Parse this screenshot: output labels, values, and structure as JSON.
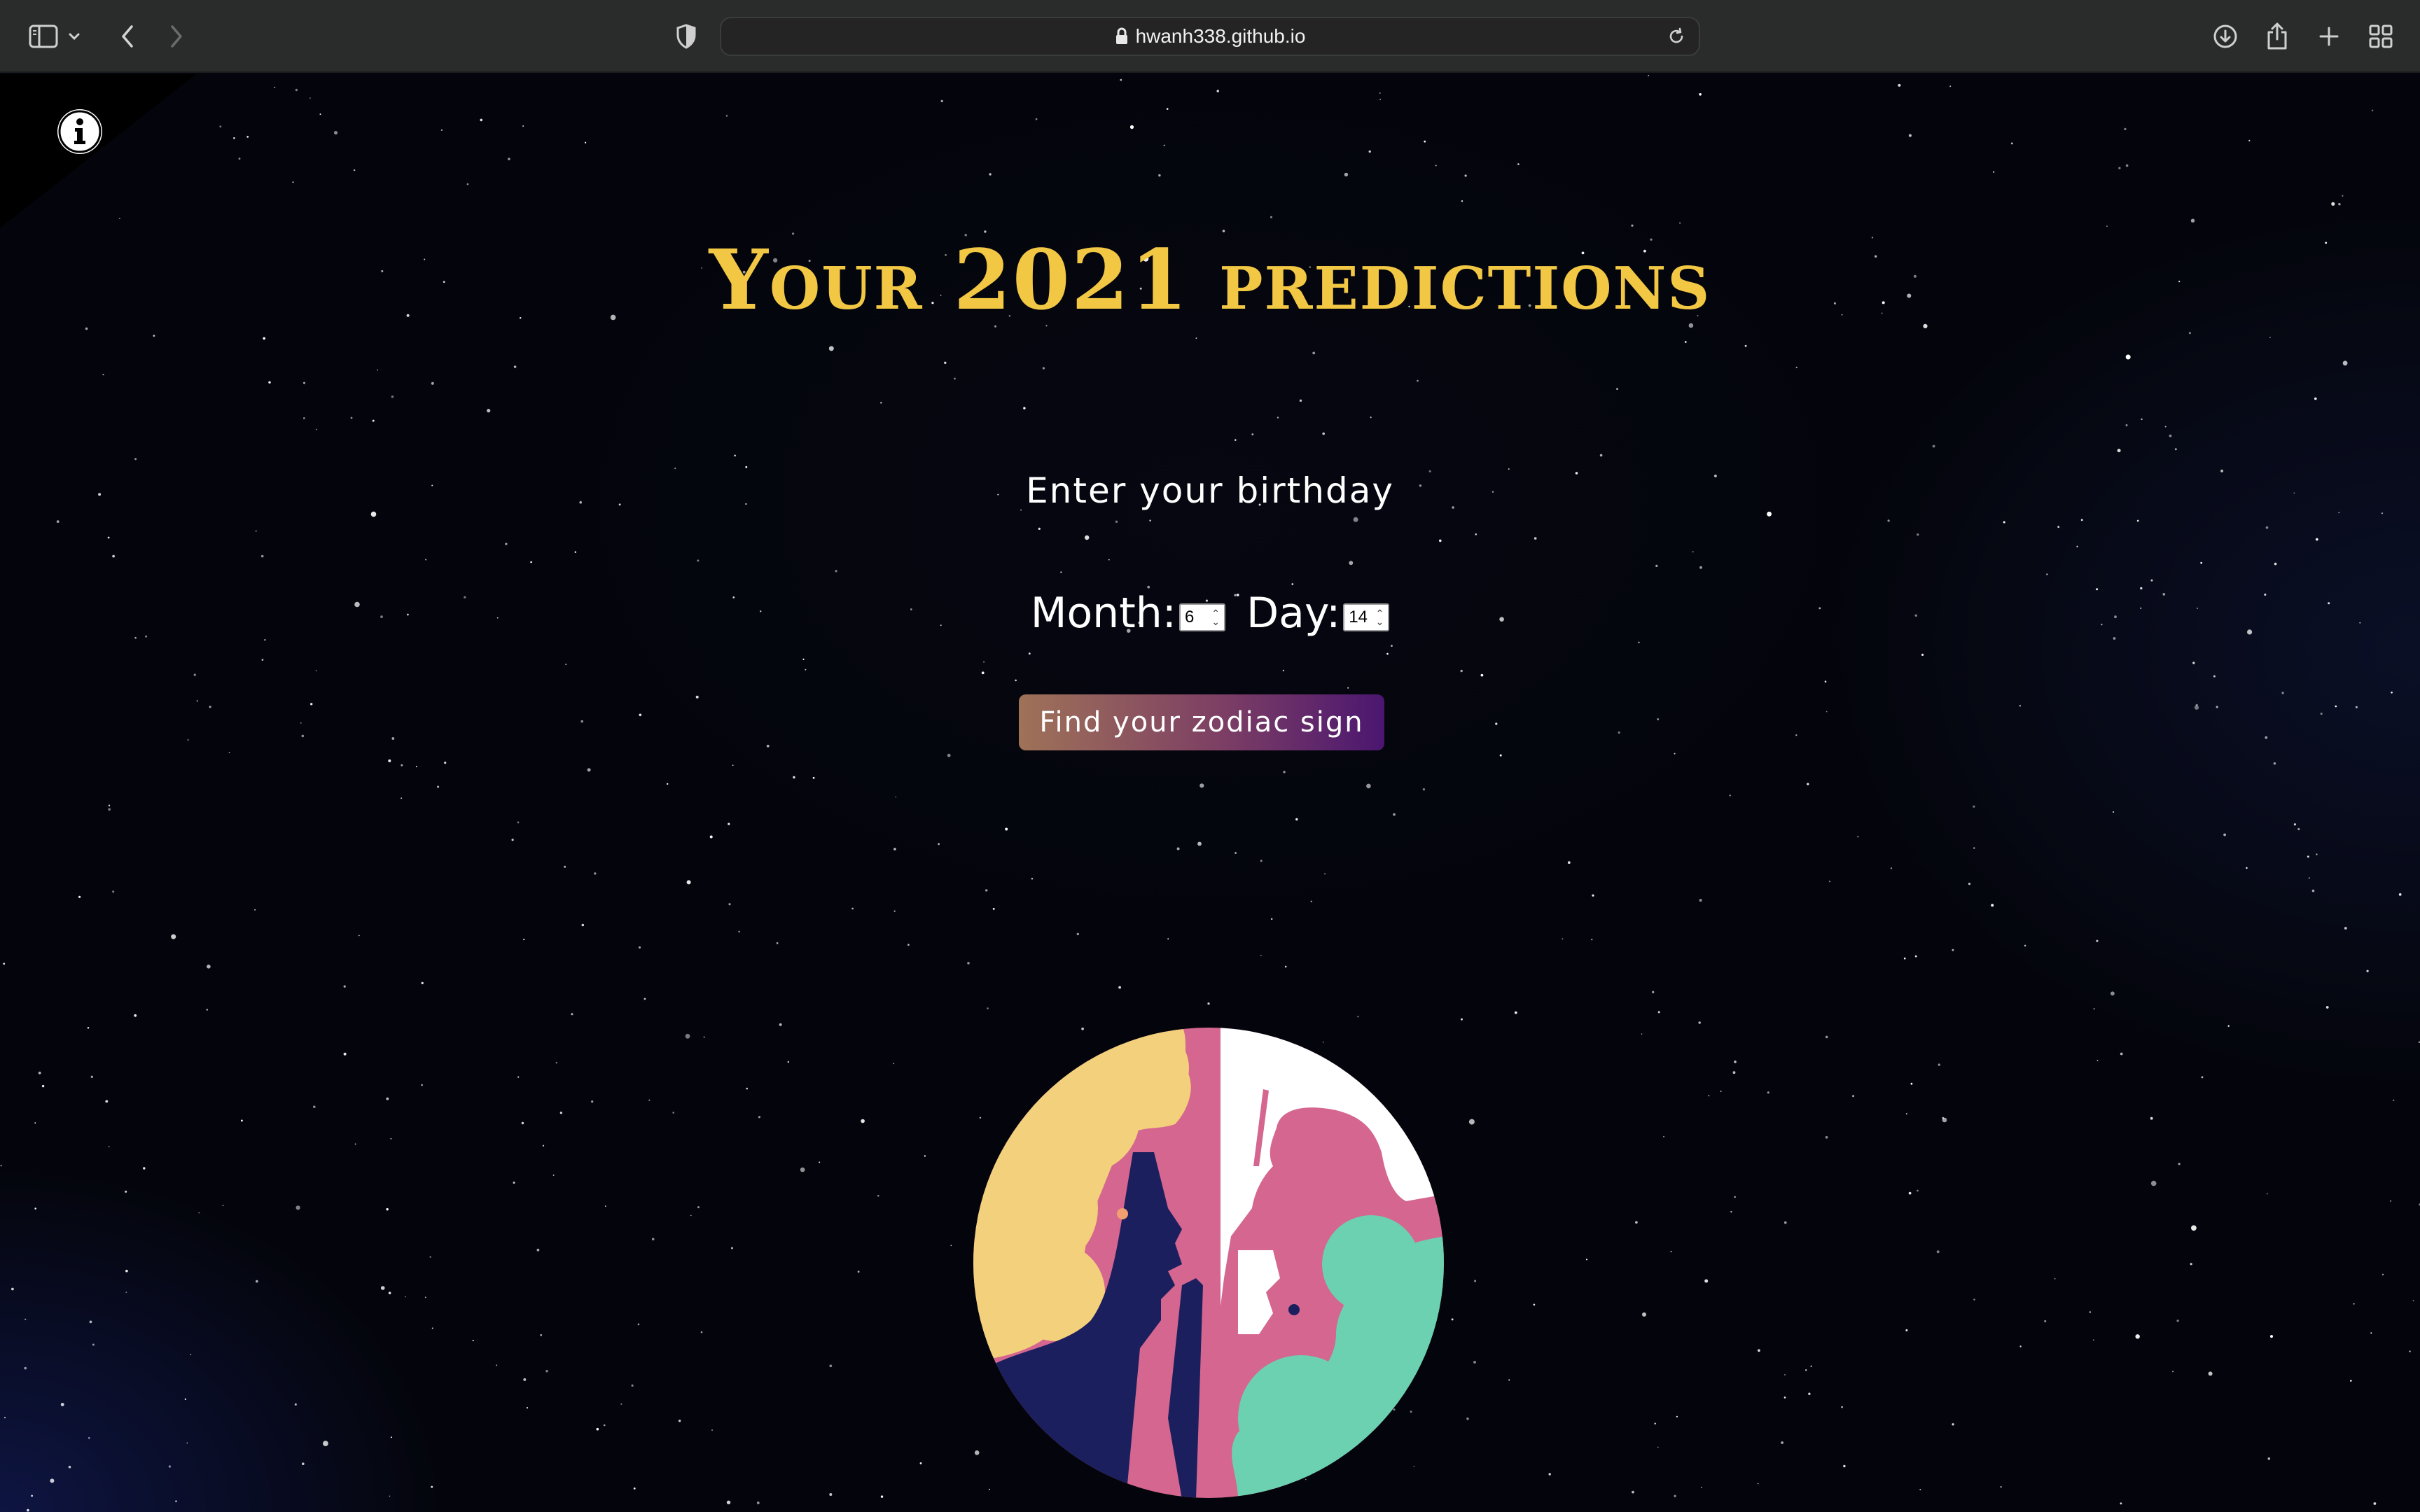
{
  "browser": {
    "url": "hwanh338.github.io",
    "icons": [
      "sidebar-icon",
      "chevron-down-icon",
      "back-arrow-icon",
      "forward-arrow-icon",
      "shield-icon",
      "lock-icon",
      "reload-icon",
      "download-icon",
      "share-icon",
      "plus-icon",
      "tab-overview-icon"
    ]
  },
  "page": {
    "title": "Your 2021 predictions",
    "subtitle": "Enter your birthday",
    "form": {
      "month_label": "Month:",
      "month_value": "6",
      "day_label": "Day:",
      "day_value": "14"
    },
    "submit_label": "Find your zodiac sign",
    "info_icon": "info-icon",
    "colors": {
      "title": "#f2c744",
      "button_start": "#9f7258",
      "button_end": "#4b1670",
      "illustration_yellow": "#f3d07c",
      "illustration_pink": "#d4668f",
      "illustration_navy": "#1b1f5e",
      "illustration_teal": "#6cd1b0"
    }
  }
}
